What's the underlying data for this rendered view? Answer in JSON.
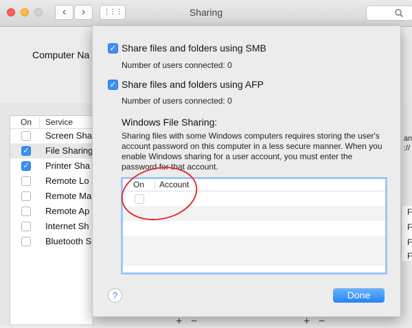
{
  "window": {
    "title": "Sharing"
  },
  "toolbar": {
    "back_glyph": "‹",
    "forward_glyph": "›",
    "grid_glyph": "⋮⋮⋮"
  },
  "underlying": {
    "computer_name_label": "Computer Na",
    "service_header": {
      "on": "On",
      "service": "Service"
    },
    "services": [
      {
        "name": "Screen Sha",
        "on": false
      },
      {
        "name": "File Sharing",
        "on": true
      },
      {
        "name": "Printer Sha",
        "on": true
      },
      {
        "name": "Remote Lo",
        "on": false
      },
      {
        "name": "Remote Ma",
        "on": false
      },
      {
        "name": "Remote Ap",
        "on": false
      },
      {
        "name": "Internet Sh",
        "on": false
      },
      {
        "name": "Bluetooth S",
        "on": false
      }
    ],
    "right_fragments": [
      "and",
      "://",
      "F",
      "F",
      "F",
      "F"
    ],
    "plus": "+",
    "minus": "−"
  },
  "sheet": {
    "smb": {
      "label": "Share files and folders using SMB",
      "checked": true,
      "users": "Number of users connected: 0"
    },
    "afp": {
      "label": "Share files and folders using AFP",
      "checked": true,
      "users": "Number of users connected: 0"
    },
    "windows_heading": "Windows File Sharing:",
    "windows_desc": "Sharing files with some Windows computers requires storing the user's account password on this computer in a less secure manner.  When you enable Windows sharing for a user account, you must enter the password for that account.",
    "table": {
      "col_on": "On",
      "col_account": "Account"
    },
    "help": "?",
    "done": "Done"
  },
  "colors": {
    "accent": "#3d8ff5",
    "annotation": "#e03131"
  }
}
